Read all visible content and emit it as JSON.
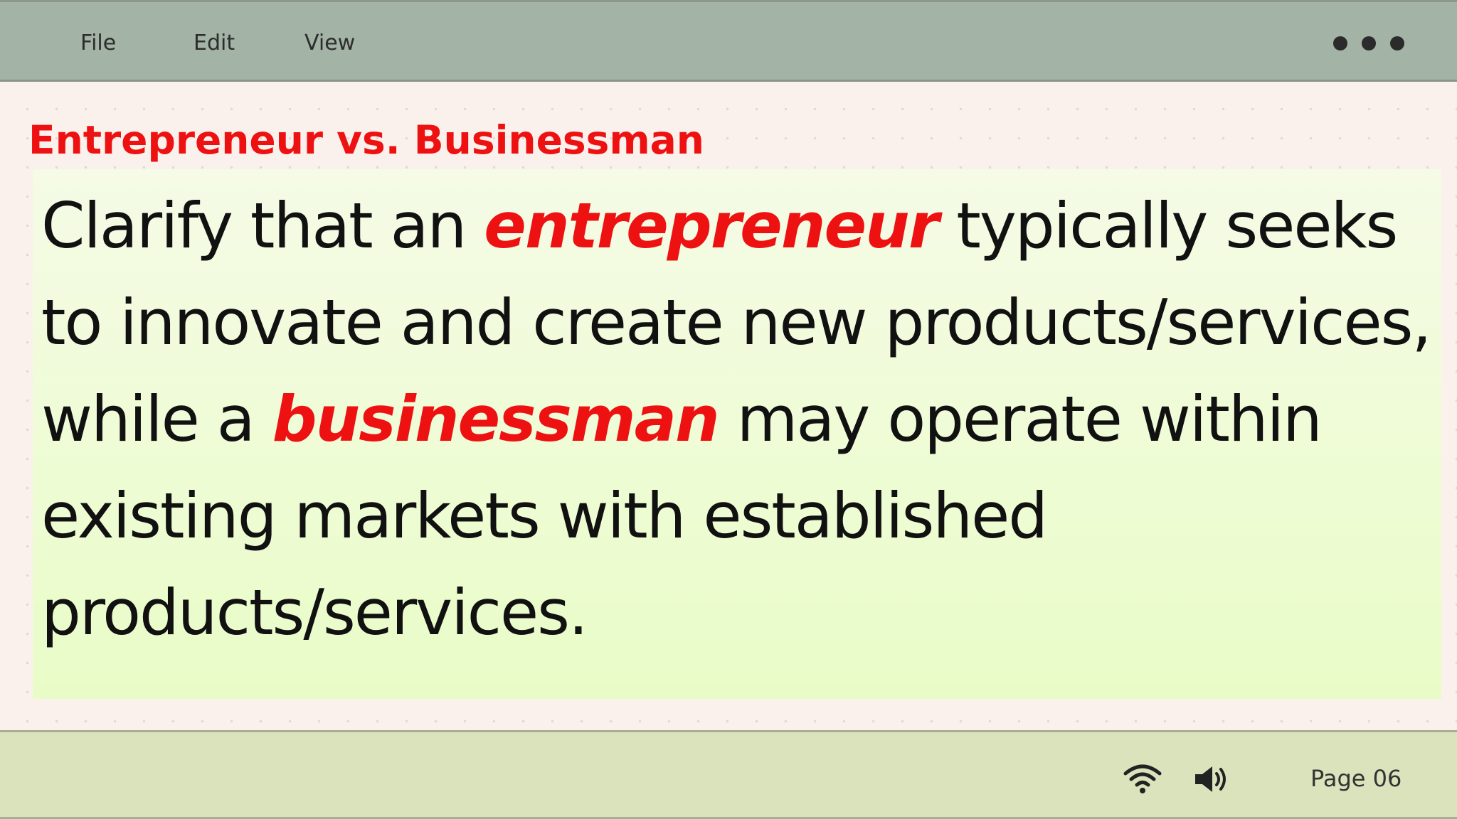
{
  "menubar": {
    "items": [
      {
        "label": "File"
      },
      {
        "label": "Edit"
      },
      {
        "label": "View"
      }
    ]
  },
  "slide": {
    "title": "Entrepreneur vs. Businessman",
    "body": {
      "part1": "Clarify that an ",
      "term1": "entrepreneur",
      "part2": " typically seeks to innovate and create new products/services, while a ",
      "term2": "businessman",
      "part3": " may operate within existing markets with established products/services."
    }
  },
  "statusbar": {
    "icons": [
      "wifi-icon",
      "speaker-icon"
    ],
    "page_label": "Page 06"
  },
  "colors": {
    "accent": "#ee1111",
    "menubar_bg": "#a3b3a5",
    "statusbar_bg": "#dbe3bd",
    "content_bg": "#eefbd5"
  }
}
